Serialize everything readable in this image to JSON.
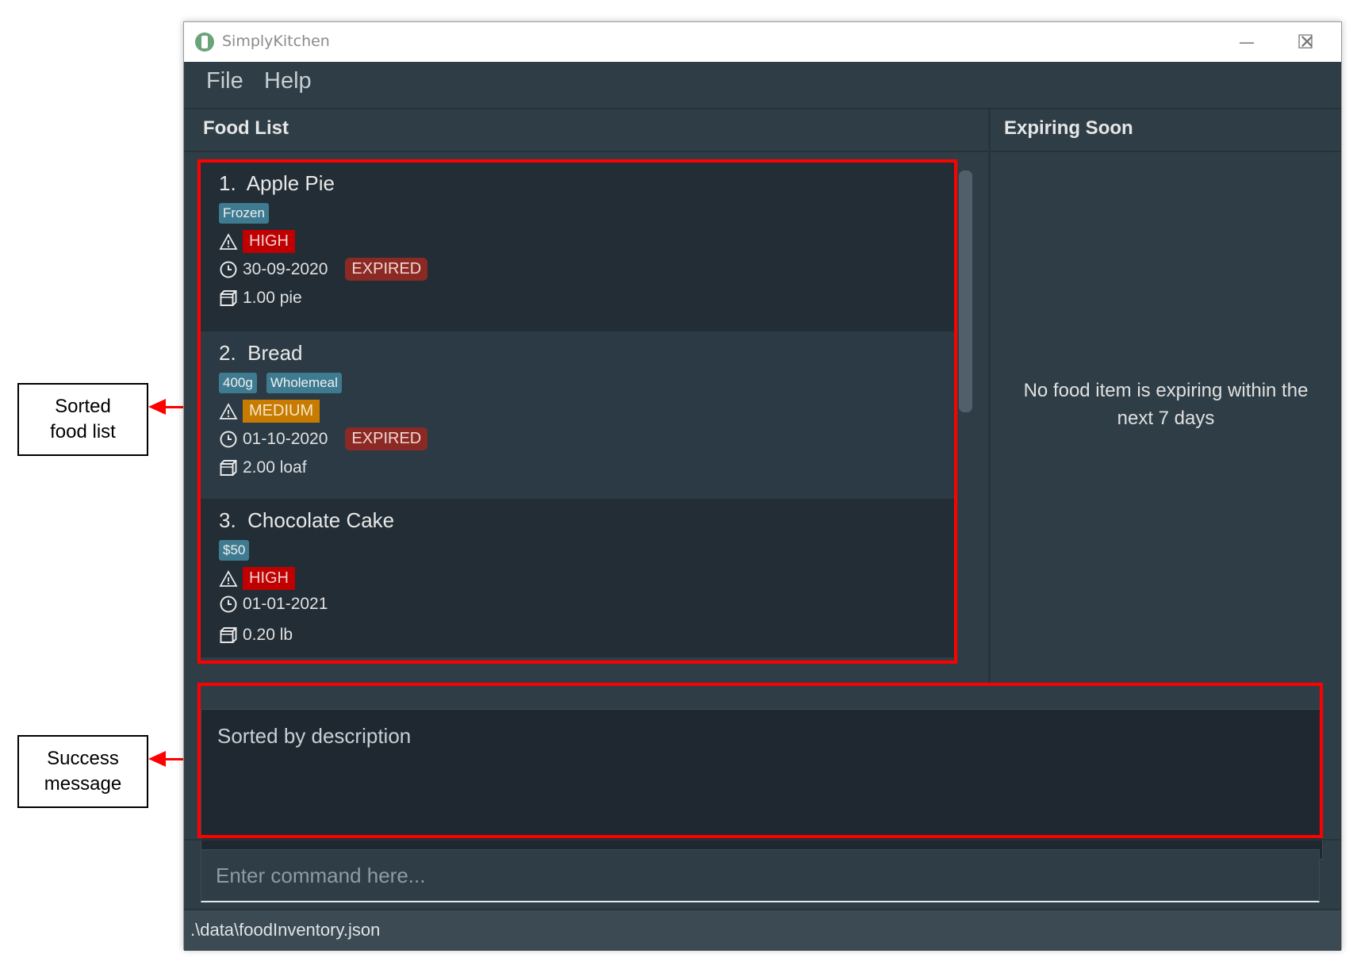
{
  "window": {
    "title": "SimplyKitchen",
    "controls": {
      "minimize": "—",
      "maximize": "☐",
      "close": "✕"
    }
  },
  "menu": {
    "items": [
      "File",
      "Help"
    ]
  },
  "panels": {
    "food_list_title": "Food List",
    "expiring_title": "Expiring Soon",
    "expiring_empty": "No food item is expiring within the next 7 days"
  },
  "food_items": [
    {
      "index": "1.",
      "name": "Apple Pie",
      "tags": [
        "Frozen"
      ],
      "priority": "HIGH",
      "priority_level": "high",
      "expiry": "30-09-2020",
      "expired_label": "EXPIRED",
      "quantity": "1.00 pie"
    },
    {
      "index": "2.",
      "name": "Bread",
      "tags": [
        "400g",
        "Wholemeal"
      ],
      "priority": "MEDIUM",
      "priority_level": "medium",
      "expiry": "01-10-2020",
      "expired_label": "EXPIRED",
      "quantity": "2.00 loaf"
    },
    {
      "index": "3.",
      "name": "Chocolate Cake",
      "tags": [
        "$50"
      ],
      "priority": "HIGH",
      "priority_level": "high",
      "expiry": "01-01-2021",
      "expired_label": "",
      "quantity": "0.20 lb"
    }
  ],
  "result": {
    "message": "Sorted by description"
  },
  "command": {
    "placeholder": "Enter command here...",
    "value": ""
  },
  "status": {
    "file_path": ".\\data\\foodInventory.json"
  },
  "annotations": {
    "sorted_list": "Sorted food list",
    "success_message": "Success message"
  },
  "colors": {
    "annotation_red": "#ff0000",
    "priority_high": "#c00000",
    "priority_medium": "#c77b00",
    "expired": "#8b2a25",
    "tag": "#3e7b91"
  }
}
